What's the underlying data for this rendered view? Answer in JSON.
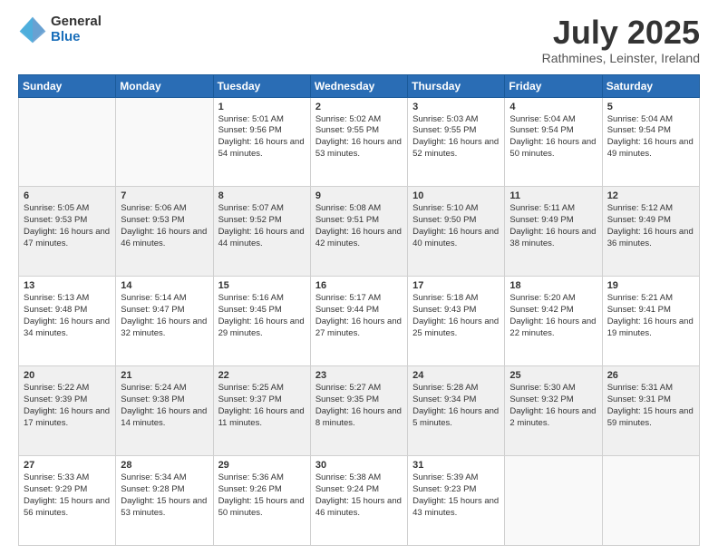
{
  "logo": {
    "general": "General",
    "blue": "Blue"
  },
  "header": {
    "title": "July 2025",
    "subtitle": "Rathmines, Leinster, Ireland"
  },
  "weekdays": [
    "Sunday",
    "Monday",
    "Tuesday",
    "Wednesday",
    "Thursday",
    "Friday",
    "Saturday"
  ],
  "weeks": [
    [
      {
        "day": "",
        "info": ""
      },
      {
        "day": "",
        "info": ""
      },
      {
        "day": "1",
        "info": "Sunrise: 5:01 AM\nSunset: 9:56 PM\nDaylight: 16 hours and 54 minutes."
      },
      {
        "day": "2",
        "info": "Sunrise: 5:02 AM\nSunset: 9:55 PM\nDaylight: 16 hours and 53 minutes."
      },
      {
        "day": "3",
        "info": "Sunrise: 5:03 AM\nSunset: 9:55 PM\nDaylight: 16 hours and 52 minutes."
      },
      {
        "day": "4",
        "info": "Sunrise: 5:04 AM\nSunset: 9:54 PM\nDaylight: 16 hours and 50 minutes."
      },
      {
        "day": "5",
        "info": "Sunrise: 5:04 AM\nSunset: 9:54 PM\nDaylight: 16 hours and 49 minutes."
      }
    ],
    [
      {
        "day": "6",
        "info": "Sunrise: 5:05 AM\nSunset: 9:53 PM\nDaylight: 16 hours and 47 minutes."
      },
      {
        "day": "7",
        "info": "Sunrise: 5:06 AM\nSunset: 9:53 PM\nDaylight: 16 hours and 46 minutes."
      },
      {
        "day": "8",
        "info": "Sunrise: 5:07 AM\nSunset: 9:52 PM\nDaylight: 16 hours and 44 minutes."
      },
      {
        "day": "9",
        "info": "Sunrise: 5:08 AM\nSunset: 9:51 PM\nDaylight: 16 hours and 42 minutes."
      },
      {
        "day": "10",
        "info": "Sunrise: 5:10 AM\nSunset: 9:50 PM\nDaylight: 16 hours and 40 minutes."
      },
      {
        "day": "11",
        "info": "Sunrise: 5:11 AM\nSunset: 9:49 PM\nDaylight: 16 hours and 38 minutes."
      },
      {
        "day": "12",
        "info": "Sunrise: 5:12 AM\nSunset: 9:49 PM\nDaylight: 16 hours and 36 minutes."
      }
    ],
    [
      {
        "day": "13",
        "info": "Sunrise: 5:13 AM\nSunset: 9:48 PM\nDaylight: 16 hours and 34 minutes."
      },
      {
        "day": "14",
        "info": "Sunrise: 5:14 AM\nSunset: 9:47 PM\nDaylight: 16 hours and 32 minutes."
      },
      {
        "day": "15",
        "info": "Sunrise: 5:16 AM\nSunset: 9:45 PM\nDaylight: 16 hours and 29 minutes."
      },
      {
        "day": "16",
        "info": "Sunrise: 5:17 AM\nSunset: 9:44 PM\nDaylight: 16 hours and 27 minutes."
      },
      {
        "day": "17",
        "info": "Sunrise: 5:18 AM\nSunset: 9:43 PM\nDaylight: 16 hours and 25 minutes."
      },
      {
        "day": "18",
        "info": "Sunrise: 5:20 AM\nSunset: 9:42 PM\nDaylight: 16 hours and 22 minutes."
      },
      {
        "day": "19",
        "info": "Sunrise: 5:21 AM\nSunset: 9:41 PM\nDaylight: 16 hours and 19 minutes."
      }
    ],
    [
      {
        "day": "20",
        "info": "Sunrise: 5:22 AM\nSunset: 9:39 PM\nDaylight: 16 hours and 17 minutes."
      },
      {
        "day": "21",
        "info": "Sunrise: 5:24 AM\nSunset: 9:38 PM\nDaylight: 16 hours and 14 minutes."
      },
      {
        "day": "22",
        "info": "Sunrise: 5:25 AM\nSunset: 9:37 PM\nDaylight: 16 hours and 11 minutes."
      },
      {
        "day": "23",
        "info": "Sunrise: 5:27 AM\nSunset: 9:35 PM\nDaylight: 16 hours and 8 minutes."
      },
      {
        "day": "24",
        "info": "Sunrise: 5:28 AM\nSunset: 9:34 PM\nDaylight: 16 hours and 5 minutes."
      },
      {
        "day": "25",
        "info": "Sunrise: 5:30 AM\nSunset: 9:32 PM\nDaylight: 16 hours and 2 minutes."
      },
      {
        "day": "26",
        "info": "Sunrise: 5:31 AM\nSunset: 9:31 PM\nDaylight: 15 hours and 59 minutes."
      }
    ],
    [
      {
        "day": "27",
        "info": "Sunrise: 5:33 AM\nSunset: 9:29 PM\nDaylight: 15 hours and 56 minutes."
      },
      {
        "day": "28",
        "info": "Sunrise: 5:34 AM\nSunset: 9:28 PM\nDaylight: 15 hours and 53 minutes."
      },
      {
        "day": "29",
        "info": "Sunrise: 5:36 AM\nSunset: 9:26 PM\nDaylight: 15 hours and 50 minutes."
      },
      {
        "day": "30",
        "info": "Sunrise: 5:38 AM\nSunset: 9:24 PM\nDaylight: 15 hours and 46 minutes."
      },
      {
        "day": "31",
        "info": "Sunrise: 5:39 AM\nSunset: 9:23 PM\nDaylight: 15 hours and 43 minutes."
      },
      {
        "day": "",
        "info": ""
      },
      {
        "day": "",
        "info": ""
      }
    ]
  ]
}
